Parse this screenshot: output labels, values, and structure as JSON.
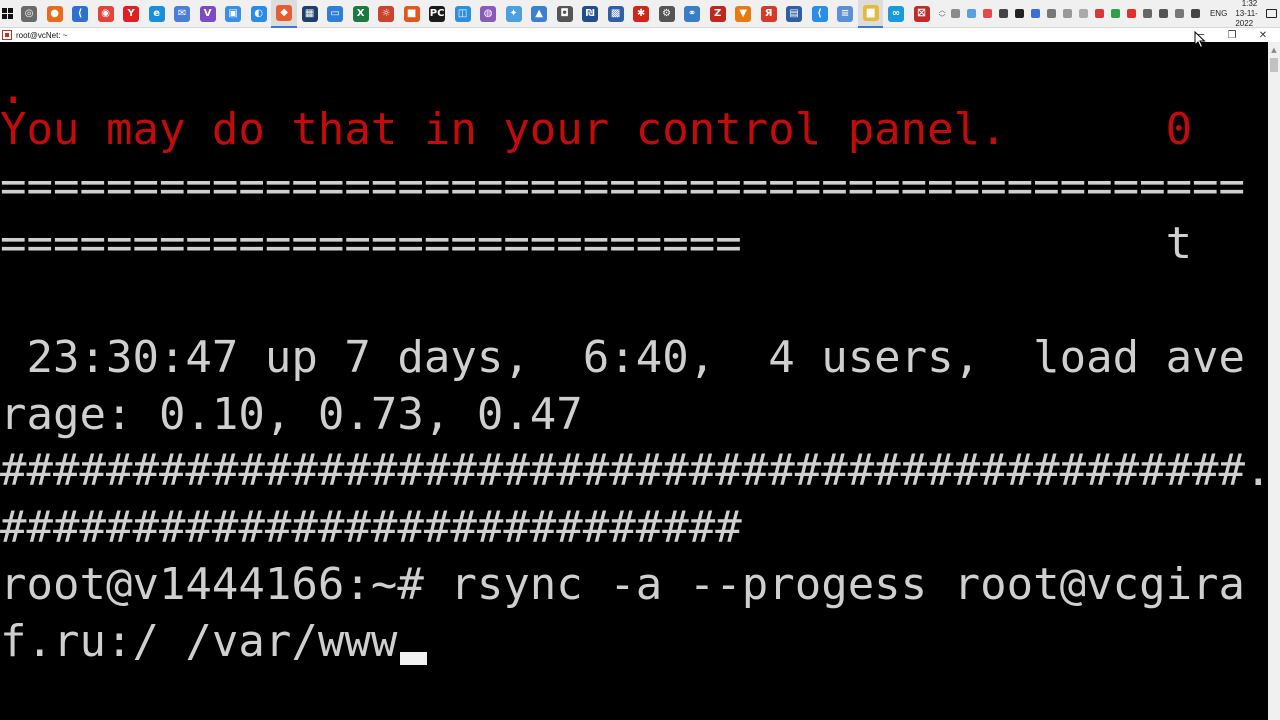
{
  "taskbar": {
    "app_icons": [
      {
        "name": "app-1",
        "color": "#6a6a6a",
        "glyph": "◎"
      },
      {
        "name": "app-2",
        "color": "#e86b1c",
        "glyph": "●"
      },
      {
        "name": "app-3",
        "color": "#2f6fd1",
        "glyph": "⟨"
      },
      {
        "name": "chrome",
        "color": "#e0443a",
        "glyph": "◉"
      },
      {
        "name": "yandex",
        "color": "#e02020",
        "glyph": "Y"
      },
      {
        "name": "edge",
        "color": "#1a8fd8",
        "glyph": "e"
      },
      {
        "name": "mail",
        "color": "#4a7fd3",
        "glyph": "✉"
      },
      {
        "name": "visual-studio",
        "color": "#7b4bc4",
        "glyph": "V"
      },
      {
        "name": "app-9",
        "color": "#3d8ee6",
        "glyph": "▣"
      },
      {
        "name": "app-10",
        "color": "#2c8be8",
        "glyph": "◐"
      },
      {
        "name": "app-11",
        "color": "#e55d30",
        "glyph": "◆",
        "active": true
      },
      {
        "name": "app-12",
        "color": "#1f3f6b",
        "glyph": "▦"
      },
      {
        "name": "app-13",
        "color": "#2f7fd8",
        "glyph": "▭"
      },
      {
        "name": "excel",
        "color": "#1d7a3e",
        "glyph": "X"
      },
      {
        "name": "app-15",
        "color": "#c9442e",
        "glyph": "☼"
      },
      {
        "name": "app-16",
        "color": "#e2571e",
        "glyph": "■"
      },
      {
        "name": "pycharm",
        "color": "#1a1a1a",
        "glyph": "PC"
      },
      {
        "name": "app-18",
        "color": "#2d8fe0",
        "glyph": "◫"
      },
      {
        "name": "app-19",
        "color": "#8a5ab8",
        "glyph": "◍"
      },
      {
        "name": "app-20",
        "color": "#4aa0e0",
        "glyph": "✦"
      },
      {
        "name": "app-21",
        "color": "#3a7fd0",
        "glyph": "▲"
      },
      {
        "name": "camera",
        "color": "#555555",
        "glyph": "◘"
      },
      {
        "name": "app-23",
        "color": "#1f4e8c",
        "glyph": "₪"
      },
      {
        "name": "app-24",
        "color": "#2f5fa8",
        "glyph": "▩"
      },
      {
        "name": "app-25",
        "color": "#d0271c",
        "glyph": "✱"
      },
      {
        "name": "settings",
        "color": "#555555",
        "glyph": "⚙"
      },
      {
        "name": "app-27",
        "color": "#3c7dc8",
        "glyph": "⚭"
      },
      {
        "name": "filezilla",
        "color": "#c0261c",
        "glyph": "Z"
      },
      {
        "name": "vlc",
        "color": "#e87a10",
        "glyph": "▼"
      },
      {
        "name": "yandex-2",
        "color": "#d73a2a",
        "glyph": "Я"
      },
      {
        "name": "app-31",
        "color": "#2f5fa0",
        "glyph": "▤"
      },
      {
        "name": "app-32",
        "color": "#2a8ee6",
        "glyph": "⟨"
      },
      {
        "name": "notepad",
        "color": "#5b8fd6",
        "glyph": "≡"
      },
      {
        "name": "explorer",
        "color": "#e6b93a",
        "glyph": "▆",
        "active": true
      },
      {
        "name": "app-35",
        "color": "#1a9ad8",
        "glyph": "∞"
      },
      {
        "name": "app-36",
        "color": "#c22a2a",
        "glyph": "⛝"
      }
    ],
    "tray_icons": [
      {
        "name": "tray-1",
        "color": "#8a8a8a"
      },
      {
        "name": "tray-2",
        "color": "#5aa0e0"
      },
      {
        "name": "tray-3",
        "color": "#e04a4a"
      },
      {
        "name": "tray-4",
        "color": "#444444"
      },
      {
        "name": "tray-5",
        "color": "#222222"
      },
      {
        "name": "tray-6",
        "color": "#3a6fd0"
      },
      {
        "name": "tray-7",
        "color": "#777777"
      },
      {
        "name": "tray-8",
        "color": "#999999"
      },
      {
        "name": "tray-9",
        "color": "#aaaaaa"
      },
      {
        "name": "tray-10",
        "color": "#d33a3a"
      },
      {
        "name": "tray-11",
        "color": "#2fa04a"
      },
      {
        "name": "tray-12",
        "color": "#e03030"
      },
      {
        "name": "tray-13",
        "color": "#666666"
      },
      {
        "name": "tray-14",
        "color": "#555555"
      },
      {
        "name": "tray-15",
        "color": "#777777"
      },
      {
        "name": "tray-16",
        "color": "#444444"
      }
    ],
    "language": "ENG",
    "clock_time": "1:32",
    "clock_date": "13-11-2022"
  },
  "window": {
    "title": "root@vcNet: ~",
    "minimize_glyph": "─",
    "maximize_glyph": "❐",
    "close_glyph": "✕"
  },
  "terminal": {
    "lines": [
      {
        "text": ".",
        "color": "red"
      },
      {
        "text": "You may do that in your control panel.      0",
        "color": "red"
      },
      {
        "text": "===============================================",
        "color": "gray"
      },
      {
        "text": "============================                t",
        "color": "gray"
      },
      {
        "text": "",
        "color": "gray"
      },
      {
        "text": " 23:30:47 up 7 days,  6:40,  4 users,  load ave",
        "color": "gray"
      },
      {
        "text": "rage: 0.10, 0.73, 0.47",
        "color": "gray"
      },
      {
        "text": "###############################################.",
        "color": "gray"
      },
      {
        "text": "############################",
        "color": "gray"
      },
      {
        "text": "root@v1444166:~# rsync -a --progess root@vcgira",
        "color": "gray"
      },
      {
        "text": "f.ru:/ /var/www",
        "color": "gray"
      }
    ]
  }
}
